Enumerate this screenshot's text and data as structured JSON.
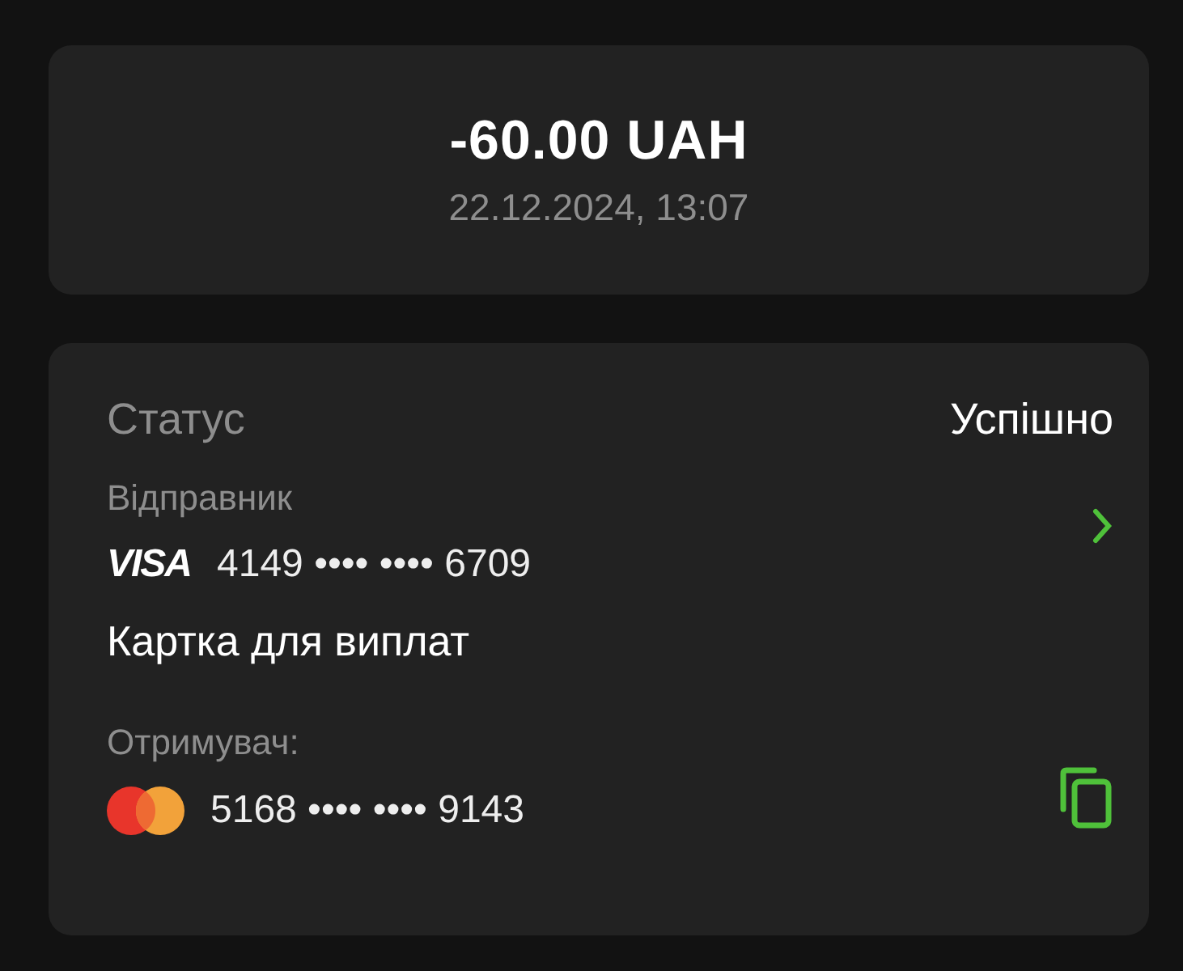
{
  "summary": {
    "amount": "-60.00 UAH",
    "datetime": "22.12.2024, 13:07"
  },
  "details": {
    "status": {
      "label": "Статус",
      "value": "Успішно"
    },
    "sender": {
      "label": "Відправник",
      "card": {
        "kind": "visa",
        "brand": "VISA",
        "number": "4149 •••• •••• 6709"
      },
      "card_name": "Картка для виплат"
    },
    "recipient": {
      "label": "Отримувач:",
      "card": {
        "kind": "mastercard",
        "number": "5168 •••• •••• 9143"
      }
    }
  }
}
